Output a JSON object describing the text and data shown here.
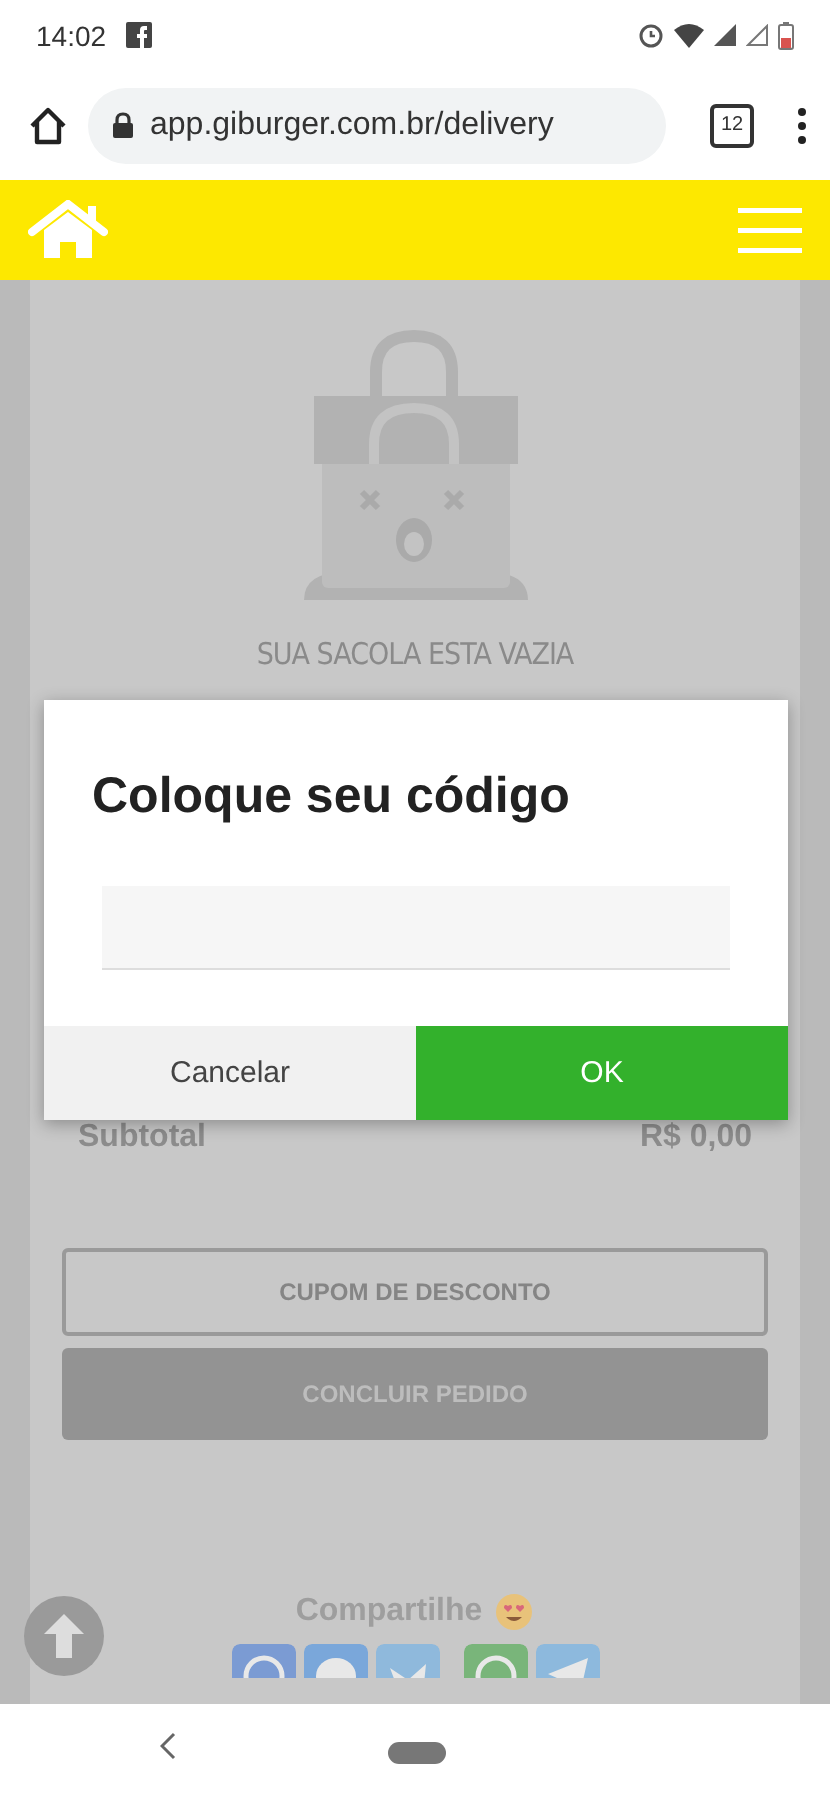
{
  "status_bar": {
    "time": "14:02"
  },
  "browser": {
    "url": "app.giburger.com.br/delivery",
    "tab_count": "12"
  },
  "cart": {
    "empty_title": "SUA SACOLA ESTA VAZIA",
    "subtotal_label": "Subtotal",
    "subtotal_value": "R$ 0,00",
    "buttons": [
      {
        "label": "CUPOM DE DESCONTO",
        "kind": "outline"
      },
      {
        "label": "CONCLUIR PEDIDO",
        "kind": "filled"
      }
    ],
    "share_label": "Compartilhe",
    "share_buttons": [
      {
        "kind": "round",
        "color": "#7b9bd3"
      },
      {
        "kind": "bubble",
        "color": "#7aa7da"
      },
      {
        "kind": "bird",
        "color": "#8fb9dc"
      },
      {
        "kind": "round",
        "color": "#79b57a"
      },
      {
        "kind": "plane",
        "color": "#8db9dd"
      }
    ]
  },
  "dialog": {
    "title": "Coloque seu código",
    "buttons": [
      {
        "label": "Cancelar",
        "kind": "secondary"
      },
      {
        "label": "OK",
        "kind": "primary"
      }
    ]
  }
}
